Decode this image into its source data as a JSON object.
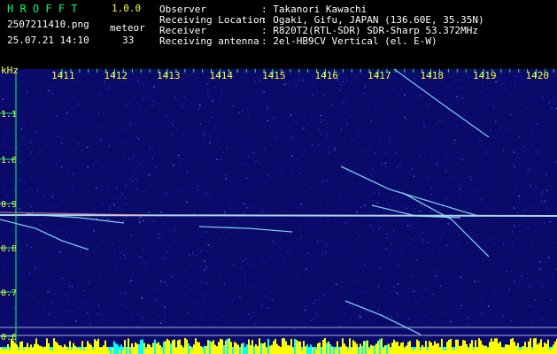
{
  "header": {
    "app_name": "H R O F F T",
    "version": "1.0.0",
    "filename": "2507211410.png",
    "datetime": "25.07.21 14:10",
    "meteor_label": "meteor",
    "meteor_count": "33",
    "info_labels": [
      "Observer",
      "Receiving Location",
      "Receiver",
      "Receiving antenna"
    ],
    "info_values": [
      ": Takanori Kawachi",
      ": Ogaki, Gifu, JAPAN (136.60E, 35.35N)",
      ": R820T2(RTL-SDR) SDR-Sharp 53.372MHz",
      ": 2el-HB9CV Vertical (el. E-W)"
    ]
  },
  "spectrogram": {
    "y_unit": "kHz",
    "y_ticks": [
      "1.1",
      "1.0",
      "0.9",
      "0.8",
      "0.7",
      "0.6"
    ],
    "x_ticks": [
      "1411",
      "1412",
      "1413",
      "1414",
      "1415",
      "1416",
      "1417",
      "1418",
      "1419",
      "1420"
    ],
    "colors": {
      "background": "#0a0a6a",
      "axis": "#00ff66",
      "tick_label": "#ffff33",
      "signal": "#8fe7ff",
      "bottom_bar": "#ffff00",
      "bottom_base": "#00ffff"
    }
  }
}
